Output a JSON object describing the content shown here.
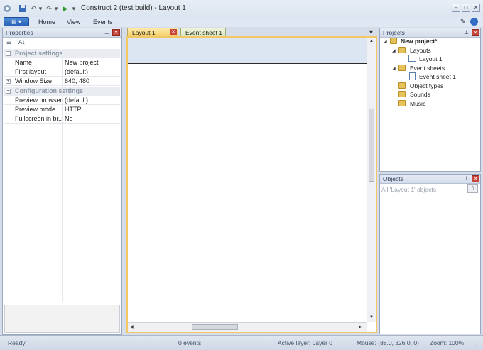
{
  "window": {
    "title": "Construct 2 (test build) - Layout 1"
  },
  "ribbon": {
    "tabs": [
      "Home",
      "View",
      "Events"
    ]
  },
  "properties": {
    "title": "Properties",
    "categories": [
      {
        "label": "Project settings",
        "rows": [
          {
            "name": "Name",
            "value": "New project"
          },
          {
            "name": "First layout",
            "value": "(default)"
          },
          {
            "name": "Window Size",
            "value": "640, 480"
          }
        ]
      },
      {
        "label": "Configuration settings",
        "rows": [
          {
            "name": "Preview browser",
            "value": "(default)"
          },
          {
            "name": "Preview mode",
            "value": "HTTP"
          },
          {
            "name": "Fullscreen in br...",
            "value": "No"
          }
        ]
      }
    ]
  },
  "document_tabs": [
    "Layout 1",
    "Event sheet 1"
  ],
  "projects": {
    "title": "Projects",
    "root": "New project*",
    "layouts_label": "Layouts",
    "layout_item": "Layout 1",
    "eventsheets_label": "Event sheets",
    "eventsheet_item": "Event sheet 1",
    "object_types": "Object types",
    "sounds": "Sounds",
    "music": "Music"
  },
  "objects": {
    "title": "Objects",
    "filter": "All 'Layout 1' objects"
  },
  "status": {
    "ready": "Ready",
    "events": "0 events",
    "active_layer": "Active layer: Layer 0",
    "mouse": "Mouse: (88.0, 326.0, 0)",
    "zoom": "Zoom: 100%"
  },
  "colors": {
    "accent": "#f2c766",
    "file_button": "#2862b8",
    "close": "#c8453a"
  }
}
